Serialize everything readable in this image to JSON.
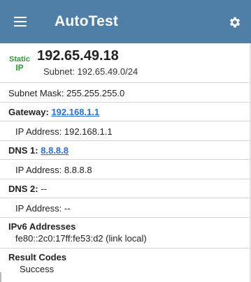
{
  "app": {
    "title": "AutoTest",
    "menu_icon": "hamburger-menu-icon",
    "settings_icon": "gear-icon",
    "bar_color": "#4f7fa6"
  },
  "status": {
    "badge_line1": "Static",
    "badge_line2": "IP",
    "badge_color": "#2a9d3a",
    "ip_address": "192.65.49.18",
    "subnet_label": "Subnet:",
    "subnet_value": "192.65.49.0/24"
  },
  "details": {
    "subnet_mask_label": "Subnet Mask:",
    "subnet_mask_value": "255.255.255.0",
    "gateway_label": "Gateway:",
    "gateway_link": "192.168.1.1",
    "gateway_ip_label": "IP Address:",
    "gateway_ip_value": "192.168.1.1",
    "dns1_label": "DNS 1:",
    "dns1_link": "8.8.8.8",
    "dns1_ip_label": "IP Address:",
    "dns1_ip_value": "8.8.8.8",
    "dns2_label": "DNS 2:",
    "dns2_value": "--",
    "dns2_ip_label": "IP Address:",
    "dns2_ip_value": "--",
    "ipv6_label": "IPv6 Addresses",
    "ipv6_value": "fe80::2c0:17ff:fe53:d2 (link local)",
    "result_label": "Result Codes",
    "result_value": "Success",
    "link_color": "#2b6fd6"
  }
}
